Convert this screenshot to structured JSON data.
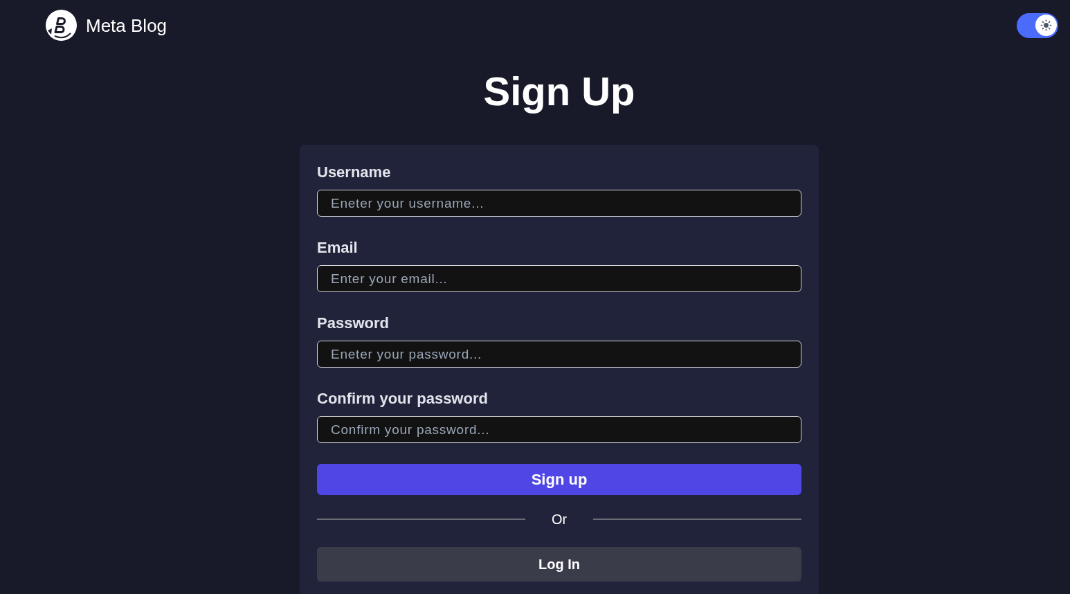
{
  "header": {
    "brand": "Meta Blog",
    "theme_toggle": {
      "on": true
    }
  },
  "title": "Sign Up",
  "form": {
    "fields": [
      {
        "label": "Username",
        "placeholder": "Eneter your username..."
      },
      {
        "label": "Email",
        "placeholder": "Enter your email..."
      },
      {
        "label": "Password",
        "placeholder": "Eneter your password..."
      },
      {
        "label": "Confirm your password",
        "placeholder": "Confirm your password..."
      }
    ],
    "submit_button": "Sign up",
    "divider": "Or",
    "login_button": "Log In"
  }
}
